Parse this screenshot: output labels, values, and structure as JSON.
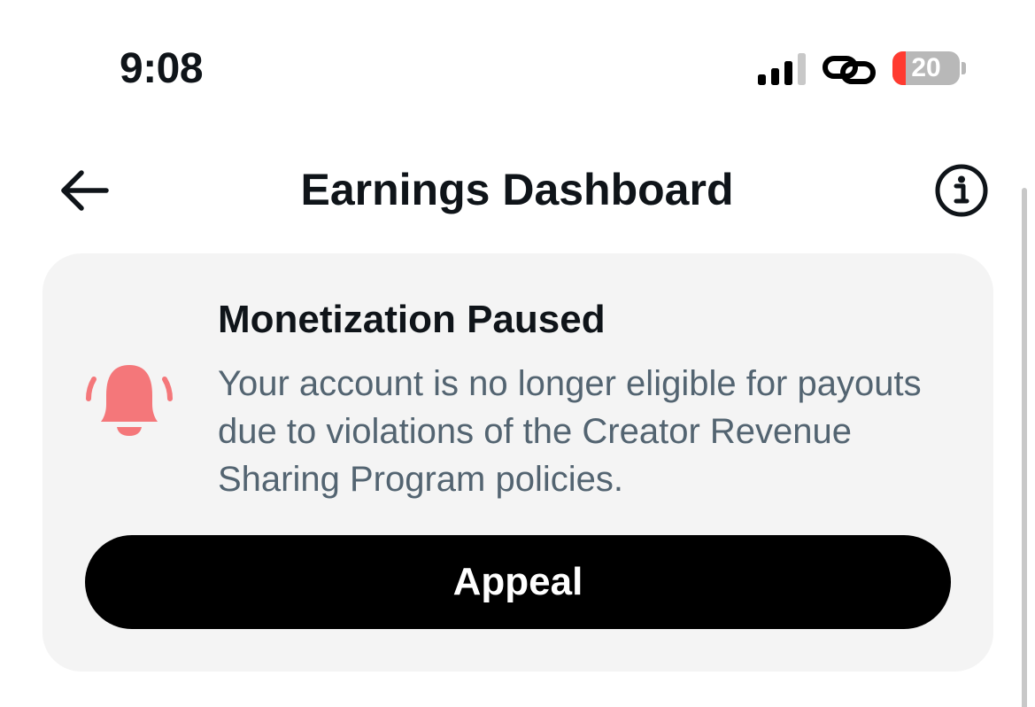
{
  "status_bar": {
    "time": "9:08",
    "battery_level": "20",
    "battery_color": "#ff3b30",
    "signal_icon": "cellular-signal-icon",
    "connection_icon": "link-icon"
  },
  "header": {
    "title": "Earnings Dashboard",
    "back_icon": "back-arrow-icon",
    "info_icon": "info-icon"
  },
  "notice": {
    "icon": "bell-icon",
    "icon_color": "#f4777a",
    "title": "Monetization Paused",
    "message": "Your account is no longer eligible for payouts due to violations of the Creator Revenue Sharing Program policies.",
    "action_label": "Appeal"
  }
}
